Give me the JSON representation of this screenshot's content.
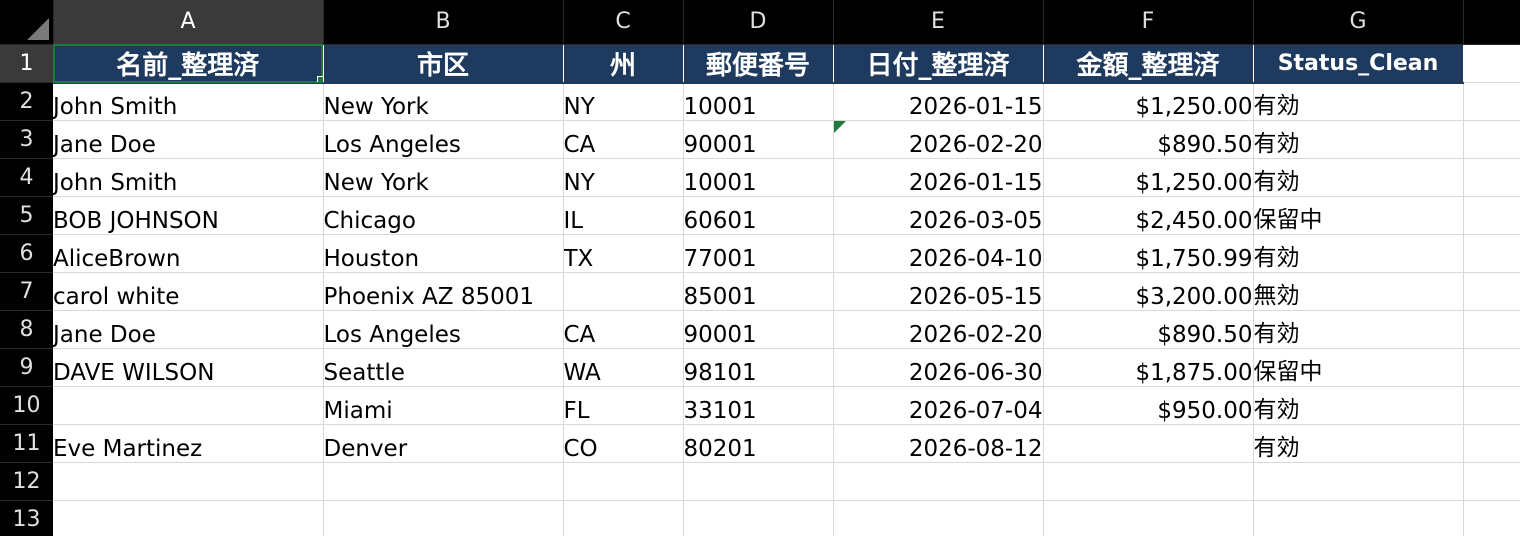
{
  "columns": [
    "A",
    "B",
    "C",
    "D",
    "E",
    "F",
    "G"
  ],
  "header_row": {
    "row_number": "1",
    "cells": [
      "名前_整理済",
      "市区",
      "州",
      "郵便番号",
      "日付_整理済",
      "金額_整理済",
      "Status_Clean"
    ]
  },
  "rows": [
    {
      "row_number": "2",
      "cells": [
        "John Smith",
        "New York",
        "NY",
        "10001",
        "2026-01-15",
        "$1,250.00",
        "有効"
      ]
    },
    {
      "row_number": "3",
      "cells": [
        "Jane Doe",
        "Los Angeles",
        "CA",
        "90001",
        "2026-02-20",
        "$890.50",
        "有効"
      ]
    },
    {
      "row_number": "4",
      "cells": [
        "John Smith",
        "New York",
        "NY",
        "10001",
        "2026-01-15",
        "$1,250.00",
        "有効"
      ]
    },
    {
      "row_number": "5",
      "cells": [
        "BOB JOHNSON",
        "Chicago",
        "IL",
        "60601",
        "2026-03-05",
        "$2,450.00",
        "保留中"
      ]
    },
    {
      "row_number": "6",
      "cells": [
        "AliceBrown",
        "Houston",
        "TX",
        "77001",
        "2026-04-10",
        "$1,750.99",
        "有効"
      ]
    },
    {
      "row_number": "7",
      "cells": [
        "carol white",
        "Phoenix AZ 85001",
        "",
        "85001",
        "2026-05-15",
        "$3,200.00",
        "無効"
      ]
    },
    {
      "row_number": "8",
      "cells": [
        "Jane Doe",
        "Los Angeles",
        "CA",
        "90001",
        "2026-02-20",
        "$890.50",
        "有効"
      ]
    },
    {
      "row_number": "9",
      "cells": [
        "DAVE WILSON",
        "Seattle",
        "WA",
        "98101",
        "2026-06-30",
        "$1,875.00",
        "保留中"
      ]
    },
    {
      "row_number": "10",
      "cells": [
        "",
        "Miami",
        "FL",
        "33101",
        "2026-07-04",
        "$950.00",
        "有効"
      ]
    },
    {
      "row_number": "11",
      "cells": [
        "Eve Martinez",
        "Denver",
        "CO",
        "80201",
        "2026-08-12",
        "",
        "有効"
      ]
    },
    {
      "row_number": "12",
      "cells": [
        "",
        "",
        "",
        "",
        "",
        "",
        ""
      ]
    },
    {
      "row_number": "13",
      "cells": [
        "",
        "",
        "",
        "",
        "",
        "",
        ""
      ]
    }
  ],
  "colors": {
    "header_fill": "#1f3a5f",
    "active_cell_border": "#1e7a3a",
    "sheet_header_bg": "#000000"
  }
}
